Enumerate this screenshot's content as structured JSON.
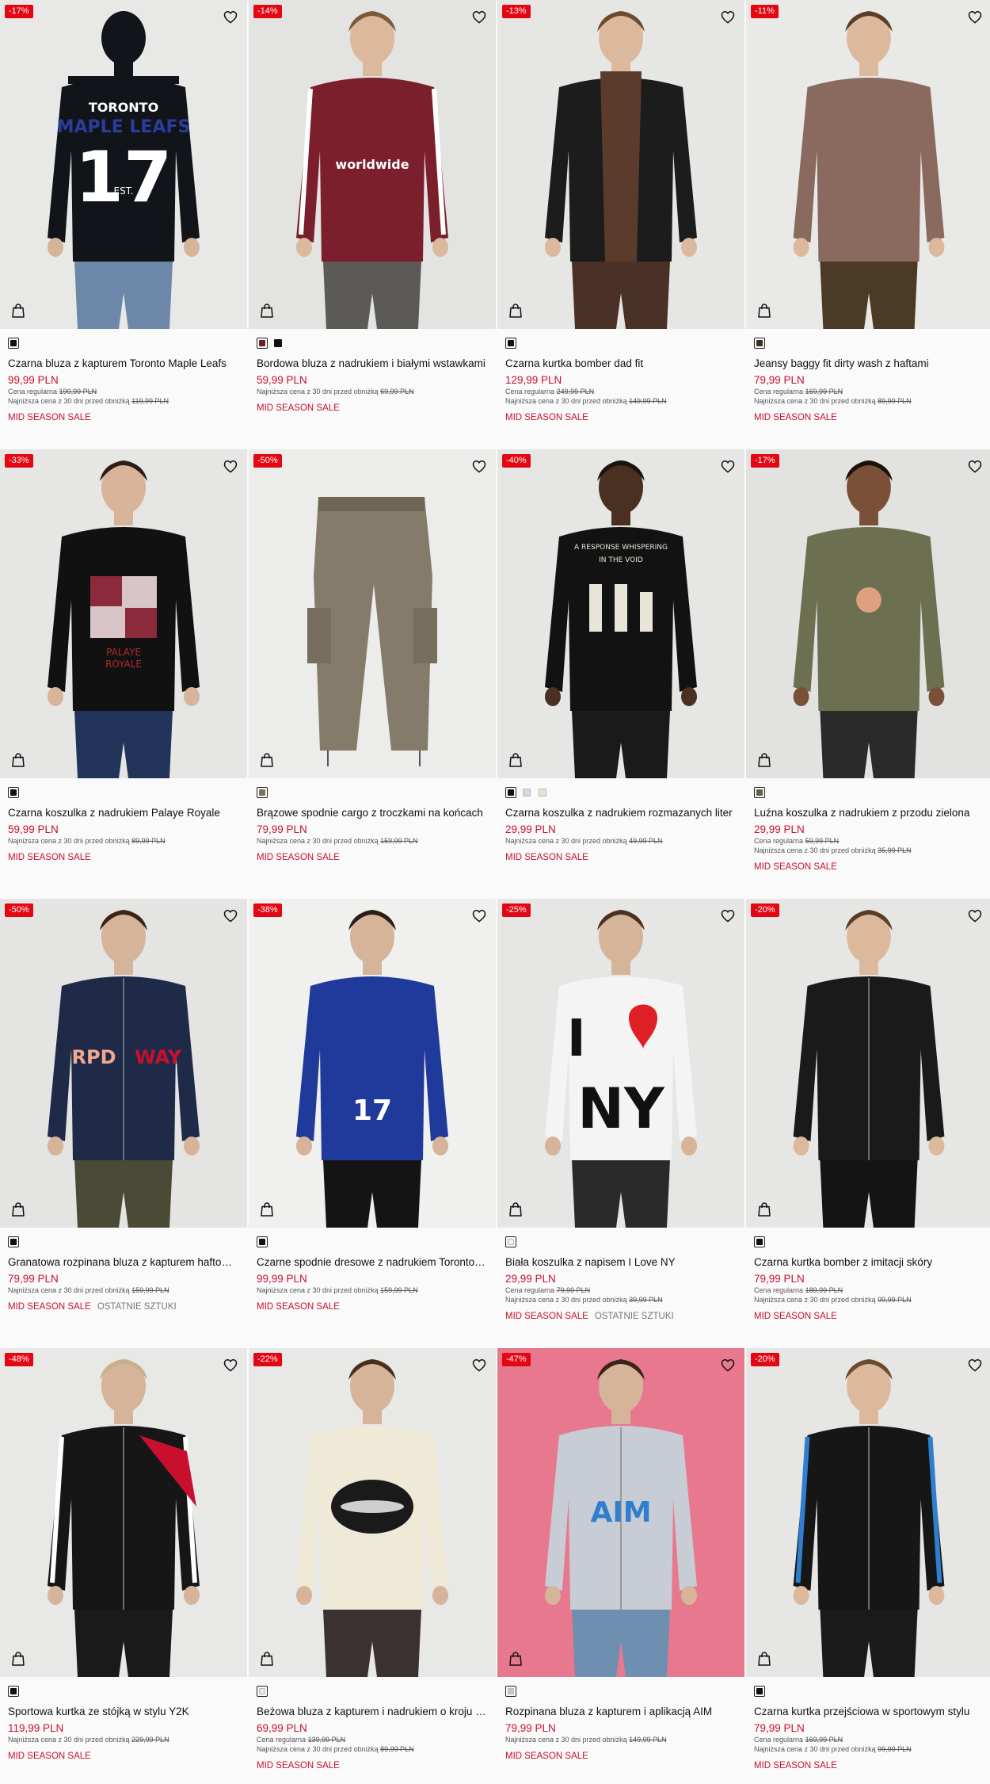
{
  "colors": {
    "sale_red": "#e30613",
    "price_red": "#c8102e"
  },
  "products": [
    {
      "badge": "-17%",
      "name": "Czarna bluza z kapturem Toronto Maple Leafs",
      "price": "99,99 PLN",
      "regular_label": "Cena regularna",
      "regular_price": "199,99 PLN",
      "lowest_label": "Najniższa cena z 30 dni przed obniżką",
      "lowest_price": "119,99 PLN",
      "tags": [
        "MID SEASON SALE"
      ],
      "swatches": [
        "#111111"
      ],
      "selected_swatch": 0,
      "bg": "#e8e8e6",
      "garment": "#111418",
      "pants": "#6d87a8",
      "skin": "#d6b49a",
      "hair": "#3a2a20",
      "back_view": true,
      "print_text": [
        "TORONTO",
        "MAPLE LEAFS",
        "17",
        "EST."
      ],
      "print_color": "#ffffff",
      "print_accent": "#2a3d9c",
      "icons": [
        "heart-icon",
        "shopping-bag-icon"
      ]
    },
    {
      "badge": "-14%",
      "name": "Bordowa bluza z nadrukiem i białymi wstawkami",
      "price": "59,99 PLN",
      "regular_label": "",
      "regular_price": "",
      "lowest_label": "Najniższa cena z 30 dni przed obniżką",
      "lowest_price": "69,99 PLN",
      "tags": [
        "MID SEASON SALE"
      ],
      "swatches": [
        "#6b1e24",
        "#111111"
      ],
      "selected_swatch": 0,
      "bg": "#e3e3e1",
      "garment": "#7a1f2b",
      "pants": "#5b5a56",
      "skin": "#dcb89c",
      "hair": "#7a5a3a",
      "back_view": false,
      "print_text": [
        "worldwide"
      ],
      "print_color": "#ffffff",
      "print_accent": "#ffffff",
      "icons": [
        "heart-icon",
        "shopping-bag-icon"
      ]
    },
    {
      "badge": "-13%",
      "name": "Czarna kurtka bomber dad fit",
      "price": "129,99 PLN",
      "regular_label": "Cena regularna",
      "regular_price": "249,99 PLN",
      "lowest_label": "Najniższa cena z 30 dni przed obniżką",
      "lowest_price": "149,99 PLN",
      "tags": [
        "MID SEASON SALE"
      ],
      "swatches": [
        "#111111"
      ],
      "selected_swatch": 0,
      "bg": "#e6e6e4",
      "garment": "#1c1c1c",
      "pants": "#4a3026",
      "skin": "#dcb89c",
      "hair": "#6b4a2e",
      "back_view": false,
      "print_text": [],
      "print_color": "#5a3b2c",
      "print_accent": "#5a3b2c",
      "icons": [
        "heart-icon",
        "shopping-bag-icon"
      ]
    },
    {
      "badge": "-11%",
      "name": "Jeansy baggy fit dirty wash z haftami",
      "price": "79,99 PLN",
      "regular_label": "Cena regularna",
      "regular_price": "169,99 PLN",
      "lowest_label": "Najniższa cena z 30 dni przed obniżką",
      "lowest_price": "89,99 PLN",
      "tags": [
        "MID SEASON SALE"
      ],
      "swatches": [
        "#3b2e22"
      ],
      "selected_swatch": 0,
      "bg": "#e9e9e7",
      "garment": "#8a6a5e",
      "pants": "#4a3a26",
      "skin": "#dcb89c",
      "hair": "#5a3e28",
      "back_view": false,
      "print_text": [],
      "print_color": "#ffffff",
      "print_accent": "#ffffff",
      "icons": [
        "heart-icon",
        "shopping-bag-icon"
      ]
    },
    {
      "badge": "-33%",
      "name": "Czarna koszulka z nadrukiem Palaye Royale",
      "price": "59,99 PLN",
      "regular_label": "",
      "regular_price": "",
      "lowest_label": "Najniższa cena z 30 dni przed obniżką",
      "lowest_price": "89,99 PLN",
      "tags": [
        "MID SEASON SALE"
      ],
      "swatches": [
        "#111111"
      ],
      "selected_swatch": 0,
      "bg": "#e6e6e4",
      "garment": "#111111",
      "pants": "#23345a",
      "skin": "#d7b49a",
      "hair": "#2a1e16",
      "back_view": false,
      "print_text": [
        "PALAYE",
        "ROYALE"
      ],
      "print_color": "#b02a2a",
      "print_accent": "#d9c4c8",
      "icons": [
        "heart-icon",
        "shopping-bag-icon"
      ]
    },
    {
      "badge": "-50%",
      "name": "Brązowe spodnie cargo z troczkami na końcach",
      "price": "79,99 PLN",
      "regular_label": "",
      "regular_price": "",
      "lowest_label": "Najniższa cena z 30 dni przed obniżką",
      "lowest_price": "159,99 PLN",
      "tags": [
        "MID SEASON SALE"
      ],
      "swatches": [
        "#7a715f"
      ],
      "selected_swatch": 0,
      "bg": "#ececea",
      "garment": "#857b6a",
      "pants": "#857b6a",
      "skin": "#857b6a",
      "hair": "#857b6a",
      "back_view": false,
      "print_text": [],
      "print_color": "#857b6a",
      "print_accent": "#857b6a",
      "icons": [
        "heart-icon",
        "shopping-bag-icon"
      ]
    },
    {
      "badge": "-40%",
      "name": "Czarna koszulka z nadrukiem rozmazanych liter",
      "price": "29,99 PLN",
      "regular_label": "",
      "regular_price": "",
      "lowest_label": "Najniższa cena z 30 dni przed obniżką",
      "lowest_price": "49,99 PLN",
      "tags": [
        "MID SEASON SALE"
      ],
      "swatches": [
        "#111111",
        "#d8d8d8",
        "#e8e2d4"
      ],
      "selected_swatch": 0,
      "bg": "#e6e6e4",
      "garment": "#121212",
      "pants": "#1a1a1a",
      "skin": "#4a3020",
      "hair": "#1a120c",
      "back_view": false,
      "print_text": [
        "A RESPONSE WHISPERING",
        "IN THE VOID"
      ],
      "print_color": "#e8e4d8",
      "print_accent": "#e8e4d8",
      "icons": [
        "heart-icon",
        "shopping-bag-icon"
      ]
    },
    {
      "badge": "-17%",
      "name": "Luźna koszulka z nadrukiem z przodu zielona",
      "price": "29,99 PLN",
      "regular_label": "Cena regularna",
      "regular_price": "59,99 PLN",
      "lowest_label": "Najniższa cena z 30 dni przed obniżką",
      "lowest_price": "35,99 PLN",
      "tags": [
        "MID SEASON SALE"
      ],
      "swatches": [
        "#5d6444"
      ],
      "selected_swatch": 0,
      "bg": "#e2e2e0",
      "garment": "#6c7050",
      "pants": "#2a2a2a",
      "skin": "#7a5038",
      "hair": "#1a120c",
      "back_view": false,
      "print_text": [],
      "print_color": "#e0a080",
      "print_accent": "#e0a080",
      "icons": [
        "heart-icon",
        "shopping-bag-icon"
      ]
    },
    {
      "badge": "-50%",
      "name": "Granatowa rozpinana bluza z kapturem haftowana",
      "price": "79,99 PLN",
      "regular_label": "",
      "regular_price": "",
      "lowest_label": "Najniższa cena z 30 dni przed obniżką",
      "lowest_price": "159,99 PLN",
      "tags": [
        "MID SEASON SALE",
        "OSTATNIE SZTUKI"
      ],
      "swatches": [
        "#111111"
      ],
      "selected_swatch": 0,
      "bg": "#e4e4e2",
      "garment": "#1e2a48",
      "pants": "#4a4a36",
      "skin": "#d6b49a",
      "hair": "#3a2418",
      "back_view": false,
      "print_text": [
        "RPD",
        "WAY"
      ],
      "print_color": "#f0a890",
      "print_accent": "#c8102e",
      "icons": [
        "heart-icon",
        "shopping-bag-icon"
      ]
    },
    {
      "badge": "-38%",
      "name": "Czarne spodnie dresowe z nadrukiem Toronto Maple Leafs",
      "price": "99,99 PLN",
      "regular_label": "",
      "regular_price": "",
      "lowest_label": "Najniższa cena z 30 dni przed obniżką",
      "lowest_price": "159,99 PLN",
      "tags": [
        "MID SEASON SALE"
      ],
      "swatches": [
        "#111111"
      ],
      "selected_swatch": 0,
      "bg": "#f0f0ee",
      "garment": "#1f3a9a",
      "pants": "#141414",
      "skin": "#d6b49a",
      "hair": "#2a1e16",
      "back_view": false,
      "print_text": [
        "17"
      ],
      "print_color": "#ffffff",
      "print_accent": "#ffffff",
      "icons": [
        "heart-icon",
        "shopping-bag-icon"
      ]
    },
    {
      "badge": "-25%",
      "name": "Biała koszulka z napisem I Love NY",
      "price": "29,99 PLN",
      "regular_label": "Cena regularna",
      "regular_price": "79,99 PLN",
      "lowest_label": "Najniższa cena z 30 dni przed obniżką",
      "lowest_price": "39,99 PLN",
      "tags": [
        "MID SEASON SALE",
        "OSTATNIE SZTUKI"
      ],
      "swatches": [
        "#f2f2f2"
      ],
      "selected_swatch": 0,
      "bg": "#e6e6e4",
      "garment": "#f4f4f4",
      "pants": "#2a2a2a",
      "skin": "#d6b49a",
      "hair": "#4a3020",
      "back_view": false,
      "print_text": [
        "I",
        "NY"
      ],
      "print_color": "#111111",
      "print_accent": "#e01e25",
      "icons": [
        "heart-icon",
        "shopping-bag-icon"
      ]
    },
    {
      "badge": "-20%",
      "name": "Czarna kurtka bomber z imitacji skóry",
      "price": "79,99 PLN",
      "regular_label": "Cena regularna",
      "regular_price": "189,99 PLN",
      "lowest_label": "Najniższa cena z 30 dni przed obniżką",
      "lowest_price": "99,99 PLN",
      "tags": [
        "MID SEASON SALE"
      ],
      "swatches": [
        "#111111"
      ],
      "selected_swatch": 0,
      "bg": "#e6e6e4",
      "garment": "#1a1a1a",
      "pants": "#141414",
      "skin": "#dcb89c",
      "hair": "#5a3e28",
      "back_view": false,
      "print_text": [],
      "print_color": "#2a2a2a",
      "print_accent": "#2a2a2a",
      "icons": [
        "heart-icon",
        "shopping-bag-icon"
      ]
    },
    {
      "badge": "-48%",
      "name": "Sportowa kurtka ze stójką w stylu Y2K",
      "price": "119,99 PLN",
      "regular_label": "",
      "regular_price": "",
      "lowest_label": "Najniższa cena z 30 dni przed obniżką",
      "lowest_price": "229,99 PLN",
      "tags": [
        "MID SEASON SALE"
      ],
      "swatches": [
        "#111111"
      ],
      "selected_swatch": 0,
      "bg": "#e8e8e6",
      "garment": "#161616",
      "pants": "#1a1a1a",
      "skin": "#d6b49a",
      "hair": "#c9b08a",
      "back_view": false,
      "print_text": [],
      "print_color": "#c8102e",
      "print_accent": "#ffffff",
      "icons": [
        "heart-icon",
        "shopping-bag-icon"
      ]
    },
    {
      "badge": "-22%",
      "name": "Beżowa bluza z kapturem i nadrukiem o kroju oversize",
      "price": "69,99 PLN",
      "regular_label": "Cena regularna",
      "regular_price": "139,99 PLN",
      "lowest_label": "Najniższa cena z 30 dni przed obniżką",
      "lowest_price": "89,99 PLN",
      "tags": [
        "MID SEASON SALE"
      ],
      "swatches": [
        "#ece6d4"
      ],
      "selected_swatch": 0,
      "bg": "#e8e8e6",
      "garment": "#efe9d8",
      "pants": "#3a3230",
      "skin": "#d6b49a",
      "hair": "#4a2e1c",
      "back_view": false,
      "print_text": [],
      "print_color": "#222222",
      "print_accent": "#222222",
      "icons": [
        "heart-icon",
        "shopping-bag-icon"
      ]
    },
    {
      "badge": "-47%",
      "name": "Rozpinana bluza z kapturem i aplikacją AIM",
      "price": "79,99 PLN",
      "regular_label": "",
      "regular_price": "",
      "lowest_label": "Najniższa cena z 30 dni przed obniżką",
      "lowest_price": "149,99 PLN",
      "tags": [
        "MID SEASON SALE"
      ],
      "swatches": [
        "#c8c8c8"
      ],
      "selected_swatch": 0,
      "bg": "#e8788e",
      "garment": "#c8ccd4",
      "pants": "#6f8fb0",
      "skin": "#d6b49a",
      "hair": "#3a2418",
      "back_view": false,
      "print_text": [
        "AIM"
      ],
      "print_color": "#2e7fd0",
      "print_accent": "#2e7fd0",
      "icons": [
        "heart-icon",
        "shopping-bag-icon"
      ]
    },
    {
      "badge": "-20%",
      "name": "Czarna kurtka przejściowa w sportowym stylu",
      "price": "79,99 PLN",
      "regular_label": "Cena regularna",
      "regular_price": "169,99 PLN",
      "lowest_label": "Najniższa cena z 30 dni przed obniżką",
      "lowest_price": "99,99 PLN",
      "tags": [
        "MID SEASON SALE"
      ],
      "swatches": [
        "#111111"
      ],
      "selected_swatch": 0,
      "bg": "#e6e6e4",
      "garment": "#161616",
      "pants": "#1a1a1a",
      "skin": "#dcb89c",
      "hair": "#6b4a2e",
      "back_view": false,
      "print_text": [],
      "print_color": "#ffffff",
      "print_accent": "#2e7fd0",
      "icons": [
        "heart-icon",
        "shopping-bag-icon"
      ]
    }
  ]
}
